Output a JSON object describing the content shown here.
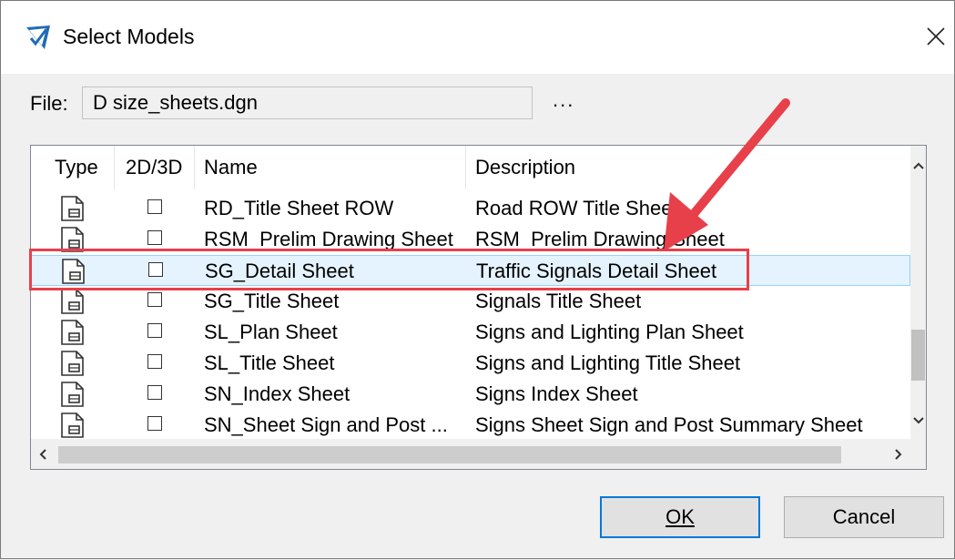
{
  "window": {
    "title": "Select Models"
  },
  "file": {
    "label": "File:",
    "value": "D size_sheets.dgn",
    "browse_label": "..."
  },
  "list": {
    "columns": [
      "Type",
      "2D/3D",
      "Name",
      "Description"
    ],
    "rows": [
      {
        "name": "RD_Title Sheet ROW",
        "description": "Road ROW Title Sheet"
      },
      {
        "name": "RSM_Prelim Drawing Sheet",
        "description": "RSM_Prelim Drawing Sheet"
      },
      {
        "name": "SG_Detail Sheet",
        "description": "Traffic Signals Detail Sheet",
        "selected": true
      },
      {
        "name": "SG_Title Sheet",
        "description": "Signals Title Sheet"
      },
      {
        "name": "SL_Plan Sheet",
        "description": "Signs and Lighting Plan Sheet"
      },
      {
        "name": "SL_Title Sheet",
        "description": "Signs and Lighting Title Sheet"
      },
      {
        "name": "SN_Index Sheet",
        "description": "Signs Index Sheet"
      },
      {
        "name": "SN_Sheet Sign and Post ...",
        "description": "Signs Sheet Sign and Post Summary Sheet"
      }
    ]
  },
  "buttons": {
    "ok": "OK",
    "cancel": "Cancel"
  },
  "icons": {
    "app": "microstation-icon",
    "close": "close-icon",
    "row_type": "model-sheet-icon",
    "annotation": "red-arrow-annotation"
  },
  "colors": {
    "selection_bg": "#e5f3ff",
    "annotation": "#e8404a",
    "default_button_border": "#0078d7"
  }
}
